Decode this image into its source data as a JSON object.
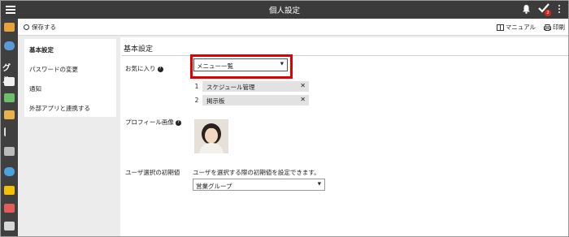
{
  "header": {
    "title": "個人設定",
    "badge_count": "2"
  },
  "toolbar": {
    "save_label": "保存する",
    "manual_label": "マニュアル",
    "print_label": "印刷"
  },
  "rail": {
    "group_label": "グル"
  },
  "sidebar": {
    "items": [
      {
        "label": "基本設定",
        "selected": true
      },
      {
        "label": "パスワードの変更",
        "selected": false
      },
      {
        "label": "通知",
        "selected": false
      },
      {
        "label": "外部アプリと連携する",
        "selected": false
      }
    ]
  },
  "main": {
    "section_title": "基本設定",
    "favorites": {
      "label": "お気に入り",
      "select_value": "メニュー一覧",
      "items": [
        {
          "num": "1",
          "label": "スケジュール管理"
        },
        {
          "num": "2",
          "label": "掲示板"
        }
      ]
    },
    "profile_image": {
      "label": "プロフィール画像"
    },
    "user_select": {
      "label": "ユーザ選択の初期値",
      "description": "ユーザを選択する際の初期値を設定できます。",
      "select_value": "営業グループ"
    }
  },
  "colors": {
    "topbar": "#3b3b3b",
    "highlight": "#e00000",
    "background": "#ececec"
  }
}
